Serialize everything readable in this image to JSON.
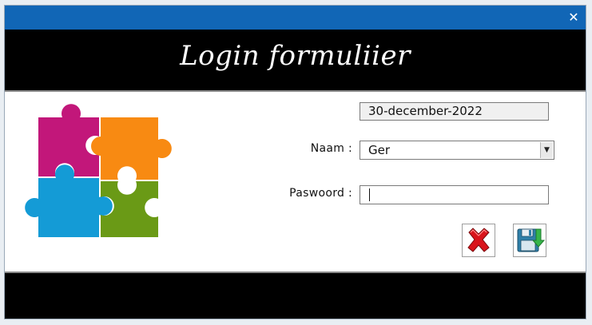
{
  "window": {
    "close_glyph": "✕",
    "title": "Login formuliier"
  },
  "form": {
    "date_value": "30-december-2022",
    "naam_label": "Naam :",
    "naam_value": "Ger",
    "password_label": "Paswoord :",
    "password_value": ""
  },
  "buttons": {
    "cancel_icon": "red-x-icon",
    "save_icon": "floppy-disk-save-icon"
  },
  "colors": {
    "titlebar": "#1166b6",
    "bands": "#000000",
    "puzzle_magenta": "#c2177a",
    "puzzle_orange": "#f88a12",
    "puzzle_blue": "#149bd6",
    "puzzle_green": "#6a9a16"
  }
}
